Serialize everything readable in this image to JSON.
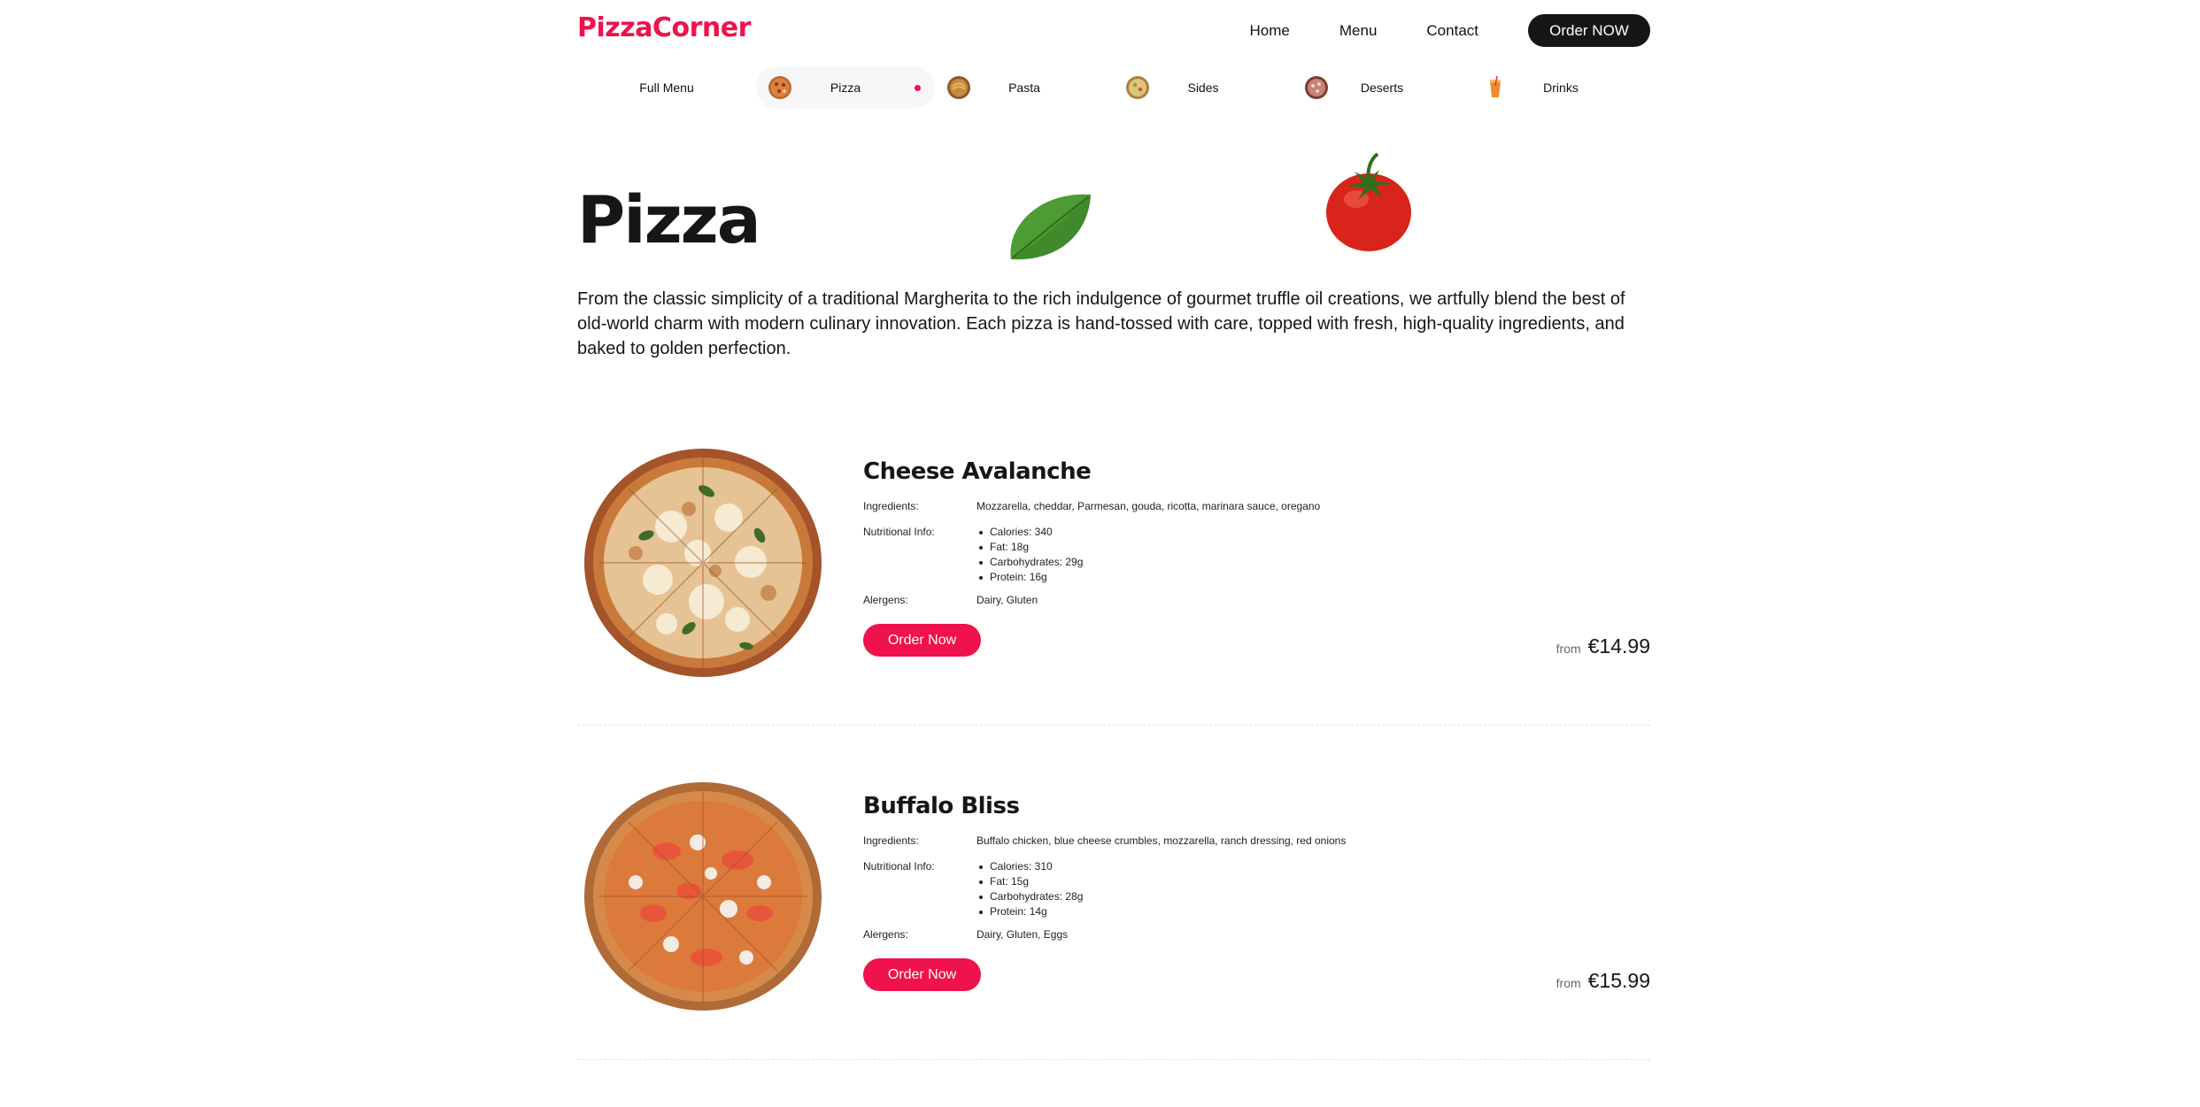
{
  "brand": {
    "logo": "PizzaCorner",
    "accent": "#f0124c"
  },
  "nav": {
    "home": "Home",
    "menu": "Menu",
    "contact": "Contact",
    "order_now": "Order NOW"
  },
  "categories": [
    {
      "label": "Full Menu",
      "icon": ""
    },
    {
      "label": "Pizza",
      "icon": "pizza-icon",
      "active": true
    },
    {
      "label": "Pasta",
      "icon": "pasta-icon"
    },
    {
      "label": "Sides",
      "icon": "sides-icon"
    },
    {
      "label": "Deserts",
      "icon": "dessert-icon"
    },
    {
      "label": "Drinks",
      "icon": "drink-icon"
    }
  ],
  "hero": {
    "title": "Pizza",
    "intro": "From the classic simplicity of a traditional Margherita to the rich indulgence of gourmet truffle oil creations, we artfully blend the best of old-world charm with modern culinary innovation. Each pizza is hand-tossed with care, topped with fresh, high-quality ingredients, and baked to golden perfection."
  },
  "labels": {
    "ingredients": "Ingredients:",
    "nutrition": "Nutritional Info:",
    "allergens": "Alergens:",
    "order": "Order Now",
    "from": "from"
  },
  "items": [
    {
      "name": "Cheese Avalanche",
      "ingredients": "Mozzarella, cheddar, Parmesan, gouda, ricotta, marinara sauce, oregano",
      "nutrition": [
        "Calories: 340",
        "Fat: 18g",
        "Carbohydrates: 29g",
        "Protein: 16g"
      ],
      "allergens": "Dairy, Gluten",
      "price": "€14.99"
    },
    {
      "name": "Buffalo Bliss",
      "ingredients": "Buffalo chicken, blue cheese crumbles, mozzarella, ranch dressing, red onions",
      "nutrition": [
        "Calories: 310",
        "Fat: 15g",
        "Carbohydrates: 28g",
        "Protein: 14g"
      ],
      "allergens": "Dairy, Gluten, Eggs",
      "price": "€15.99"
    }
  ]
}
